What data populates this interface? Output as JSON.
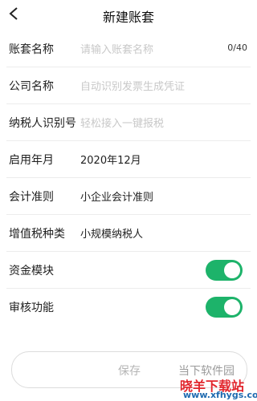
{
  "header": {
    "title": "新建账套"
  },
  "fields": [
    {
      "label": "账套名称",
      "placeholder": "请输入账套名称",
      "counter": "0/40"
    },
    {
      "label": "公司名称",
      "placeholder": "自动识别发票生成凭证"
    },
    {
      "label": "纳税人识别号",
      "placeholder": "轻松接入一键报税"
    },
    {
      "label": "启用年月",
      "value": "2020年12月"
    },
    {
      "label": "会计准则",
      "value": "小企业会计准则"
    },
    {
      "label": "增值税种类",
      "value": "小规模纳税人"
    }
  ],
  "toggles": [
    {
      "label": "资金模块",
      "on": true
    },
    {
      "label": "审核功能",
      "on": true
    }
  ],
  "save": {
    "label": "保存"
  },
  "watermark": {
    "line1": "当下软件园",
    "line2": "晓羊下载站",
    "url": "www.xfhygs.com"
  },
  "colors": {
    "toggle_on": "#1db36a",
    "placeholder": "#c8c8c8"
  }
}
